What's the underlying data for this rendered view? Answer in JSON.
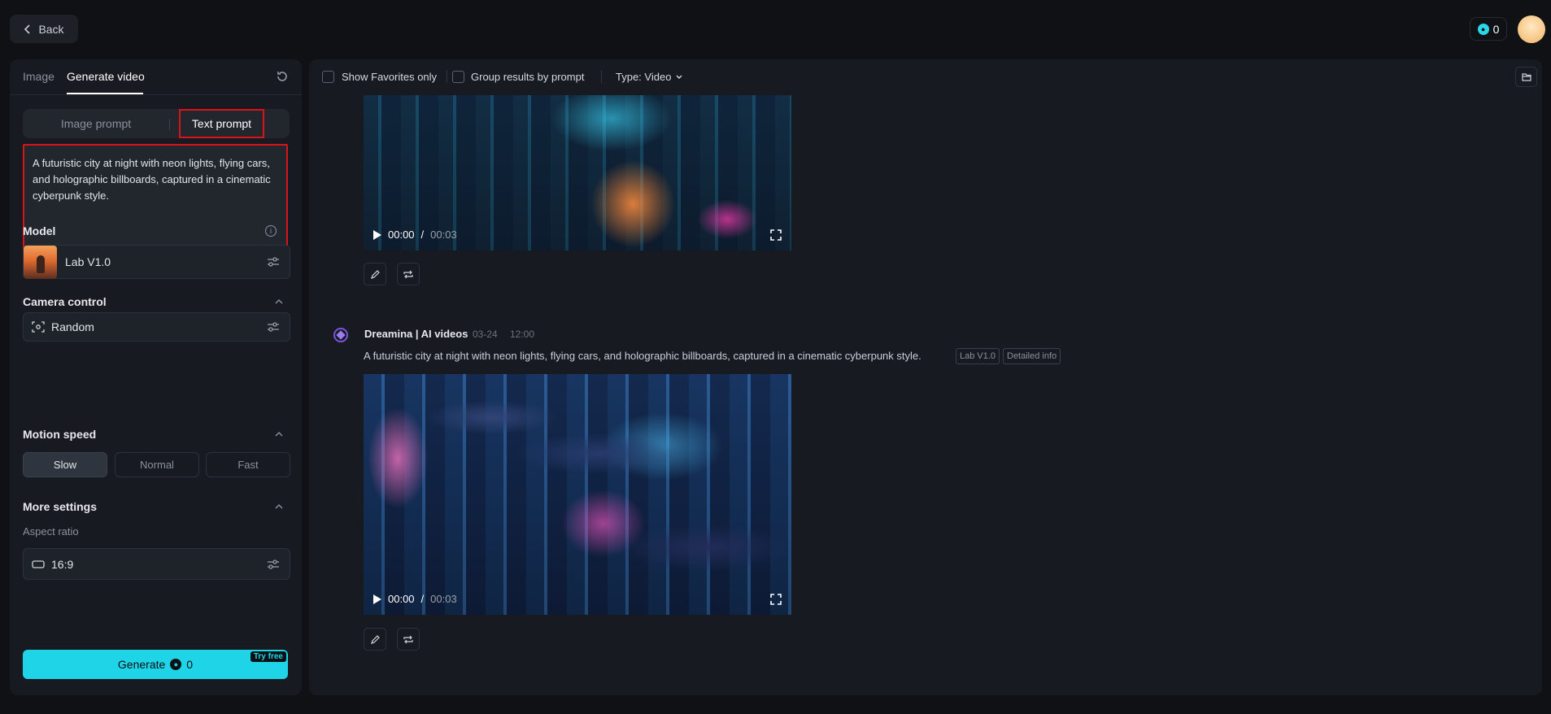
{
  "topbar": {
    "back_label": "Back",
    "credits": "0"
  },
  "left_panel": {
    "tabs": [
      {
        "label": "Image"
      },
      {
        "label": "Generate video"
      }
    ],
    "prompt_modes": [
      {
        "label": "Image prompt"
      },
      {
        "label": "Text prompt"
      }
    ],
    "prompt_text": "A futuristic city at night with neon lights, flying cars, and holographic billboards, captured in a cinematic cyberpunk style.",
    "model": {
      "section_label": "Model",
      "value": "Lab V1.0"
    },
    "camera_control": {
      "section_label": "Camera control",
      "value": "Random"
    },
    "motion_speed": {
      "section_label": "Motion speed",
      "options": [
        {
          "label": "Slow",
          "selected": true
        },
        {
          "label": "Normal",
          "selected": false
        },
        {
          "label": "Fast",
          "selected": false
        }
      ]
    },
    "more_settings": {
      "section_label": "More settings",
      "aspect_ratio_label": "Aspect ratio",
      "aspect_ratio_value": "16:9"
    },
    "generate": {
      "label": "Generate",
      "cost": "0",
      "badge": "Try free"
    }
  },
  "main": {
    "toolbar": {
      "favorites_label": "Show Favorites only",
      "group_label": "Group results by prompt",
      "type_label": "Type: Video"
    },
    "results": [
      {
        "time_current": "00:00",
        "time_separator": "/",
        "time_duration": "00:03"
      },
      {
        "author": "Dreamina | AI videos",
        "date": "03-24",
        "time": "12:00",
        "prompt": "A futuristic city at night with neon lights, flying cars, and holographic billboards, captured in a cinematic cyberpunk style.",
        "tags": [
          "Lab V1.0",
          "Detailed info"
        ],
        "time_current": "00:00",
        "time_separator": "/",
        "time_duration": "00:03"
      }
    ]
  },
  "colors": {
    "accent": "#1ed4e6",
    "highlight_border": "#d8141a",
    "background": "#0f1115",
    "panel": "#171b21"
  }
}
